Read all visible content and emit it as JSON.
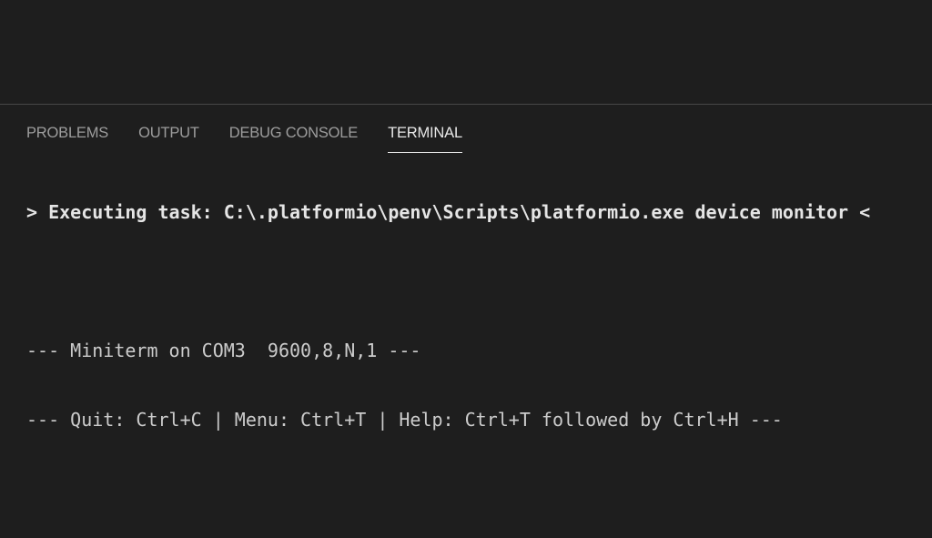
{
  "panel": {
    "tabs": [
      {
        "label": "PROBLEMS",
        "active": false
      },
      {
        "label": "OUTPUT",
        "active": false
      },
      {
        "label": "DEBUG CONSOLE",
        "active": false
      },
      {
        "label": "TERMINAL",
        "active": true
      }
    ]
  },
  "terminal": {
    "lines": [
      "> Executing task: C:\\.platformio\\penv\\Scripts\\platformio.exe device monitor <",
      "",
      "--- Miniterm on COM3  9600,8,N,1 ---",
      "--- Quit: Ctrl+C | Menu: Ctrl+T | Help: Ctrl+T followed by Ctrl+H ---"
    ]
  },
  "colors": {
    "background": "#1e1e1e",
    "tab_inactive": "#9d9d9d",
    "tab_active": "#e7e7e7",
    "terminal_text": "#cccccc",
    "panel_border": "#474747"
  }
}
